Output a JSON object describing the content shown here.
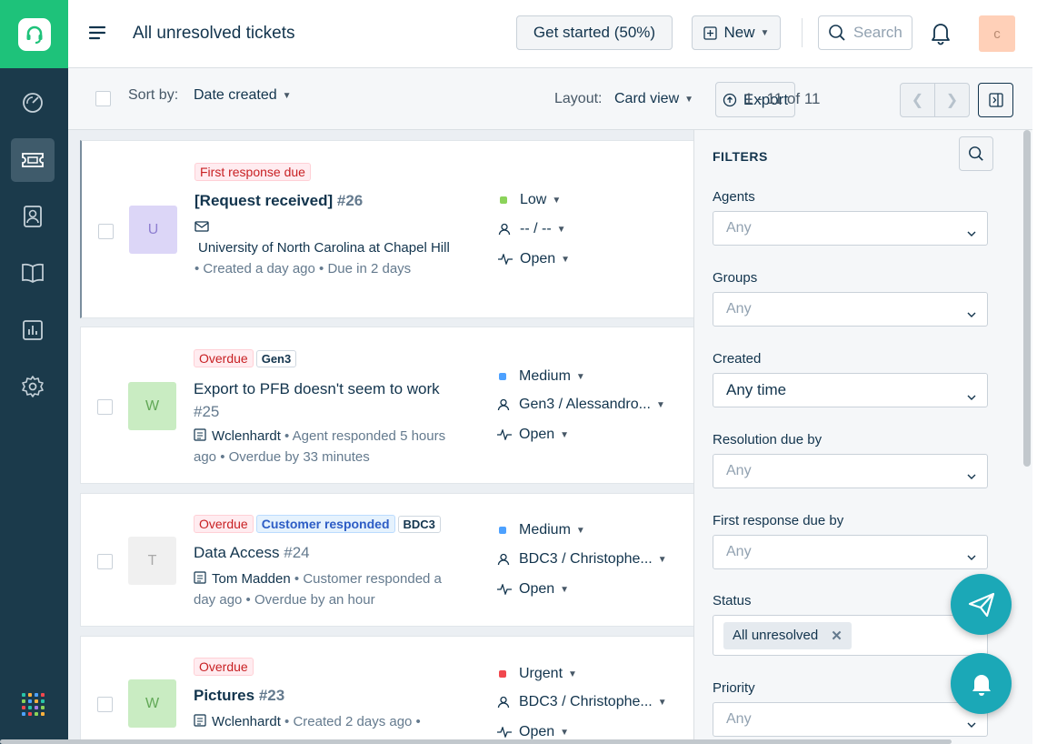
{
  "header": {
    "title": "All unresolved tickets",
    "get_started_label": "Get started (50%)",
    "new_label": "New",
    "search_placeholder": "Search",
    "avatar_initial": "c"
  },
  "toolbar": {
    "sort_label": "Sort by:",
    "sort_value": "Date created",
    "layout_label": "Layout:",
    "layout_value": "Card view",
    "export_label": "Export",
    "pagination": "1 - 11 of 11"
  },
  "tickets": [
    {
      "tags": [
        "First response due"
      ],
      "subject": "[Request received]",
      "number": "#26",
      "requester": "University of North Carolina at Chapel Hill",
      "meta": "Created a day ago",
      "meta2": "Due in 2 days",
      "avatar": "U",
      "priority": "Low",
      "assignee": "-- / --",
      "status": "Open"
    },
    {
      "tags": [
        "Overdue",
        "Gen3"
      ],
      "subject": "Export to PFB doesn't seem to work",
      "number": "#25",
      "requester": "Wclenhardt",
      "meta": "Agent responded 5 hours ago",
      "meta2": "Overdue by 33 minutes",
      "avatar": "W",
      "priority": "Medium",
      "assignee": "Gen3 / Alessandro...",
      "status": "Open"
    },
    {
      "tags": [
        "Overdue",
        "Customer responded",
        "BDC3"
      ],
      "subject": "Data Access",
      "number": "#24",
      "requester": "Tom Madden",
      "meta": "Customer responded a day ago",
      "meta2": "Overdue by an hour",
      "avatar": "T",
      "priority": "Medium",
      "assignee": "BDC3 / Christophe...",
      "status": "Open"
    },
    {
      "tags": [
        "Overdue"
      ],
      "subject": "Pictures",
      "number": "#23",
      "requester": "Wclenhardt",
      "meta": "Created 2 days ago",
      "meta2": "",
      "avatar": "W",
      "priority": "Urgent",
      "assignee": "BDC3 / Christophe...",
      "status": "Open"
    }
  ],
  "filters": {
    "title": "FILTERS",
    "agents_label": "Agents",
    "agents_value": "Any",
    "groups_label": "Groups",
    "groups_value": "Any",
    "created_label": "Created",
    "created_value": "Any time",
    "resolution_label": "Resolution due by",
    "resolution_value": "Any",
    "first_response_label": "First response due by",
    "first_response_value": "Any",
    "status_label": "Status",
    "status_chip": "All unresolved",
    "priority_label": "Priority",
    "priority_value": "Any"
  },
  "colors": {
    "brand_green": "#1ec27a",
    "sidebar": "#1b3a4b",
    "priority_low": "#8bd35a",
    "priority_medium": "#4da1ff",
    "priority_urgent": "#f1474e",
    "fab": "#1ba8b7"
  },
  "icons": [
    "headset-icon",
    "dashboard-icon",
    "ticket-icon",
    "contacts-icon",
    "book-icon",
    "reports-icon",
    "gear-icon",
    "apps-icon",
    "hamburger-icon",
    "plus-icon",
    "search-icon",
    "bell-icon",
    "export-icon",
    "chevron-left-icon",
    "chevron-right-icon",
    "panel-toggle-icon",
    "mail-icon",
    "contact-card-icon",
    "person-icon",
    "activity-icon",
    "send-icon"
  ]
}
